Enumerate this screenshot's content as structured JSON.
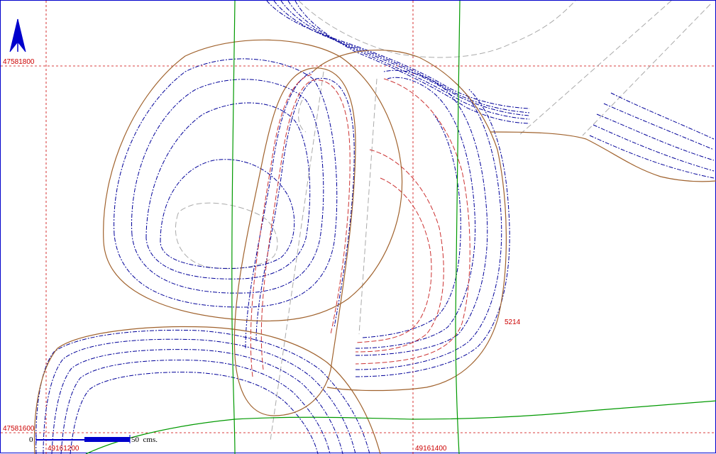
{
  "colors": {
    "frame": "#0000cc",
    "grid": "#cc0000",
    "grid_label": "#cc0000",
    "contour_blue": "#000099",
    "contour_red": "#cc3333",
    "contour_gray": "#aaaaaa",
    "contour_brown": "#a0622d",
    "boundary_green": "#009900",
    "north_arrow": "#0000cc",
    "scale_bar": "#0000cc",
    "scale_text": "#0000cc"
  },
  "grid": {
    "northings": [
      "47581800",
      "47581600"
    ],
    "eastings": [
      "49161200",
      "49161400"
    ]
  },
  "labels": {
    "elevation_label": "5214"
  },
  "scale_bar": {
    "start_label": "0",
    "end_label": "50  cms."
  },
  "icons": {
    "north_arrow": "north-arrow-icon"
  }
}
